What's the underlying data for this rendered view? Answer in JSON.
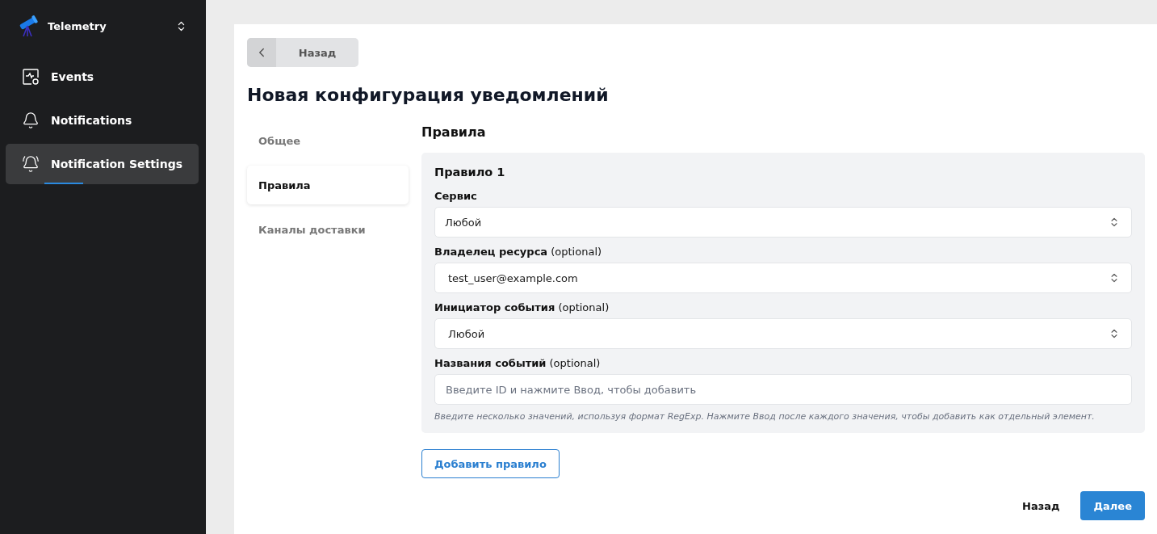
{
  "app": {
    "name": "Telemetry"
  },
  "sidebar": {
    "items": [
      {
        "label": "Events",
        "selected": false
      },
      {
        "label": "Notifications",
        "selected": false
      },
      {
        "label": "Notification Settings",
        "selected": true
      }
    ]
  },
  "back_button": {
    "label": "Назад"
  },
  "title": "Новая конфигурация уведомлений",
  "steps": [
    {
      "label": "Общее",
      "selected": false
    },
    {
      "label": "Правила",
      "selected": true
    },
    {
      "label": "Каналы доставки",
      "selected": false
    }
  ],
  "section_title": "Правила",
  "rules": [
    {
      "title": "Правило 1",
      "fields": [
        {
          "kind": "select",
          "label": "**Сервис**",
          "value": "Любой"
        },
        {
          "kind": "select",
          "label": "**Владелец ресурса** (optional)",
          "value": "test_user@example.com"
        },
        {
          "kind": "select",
          "label": "**Инициатор события** (optional)",
          "value": "Любой"
        },
        {
          "kind": "input",
          "label": "**Названия событий** (optional)",
          "placeholder": "Введите ID и нажмите Ввод, чтобы добавить",
          "hint": "Введите несколько значений, используя формат RegExp. Нажмите Ввод после каждого значения, чтобы добавить как отдельный элемент."
        }
      ]
    }
  ],
  "add_rule_button": "Добавить правило",
  "footer": {
    "back": "Назад",
    "next": "Далее"
  }
}
